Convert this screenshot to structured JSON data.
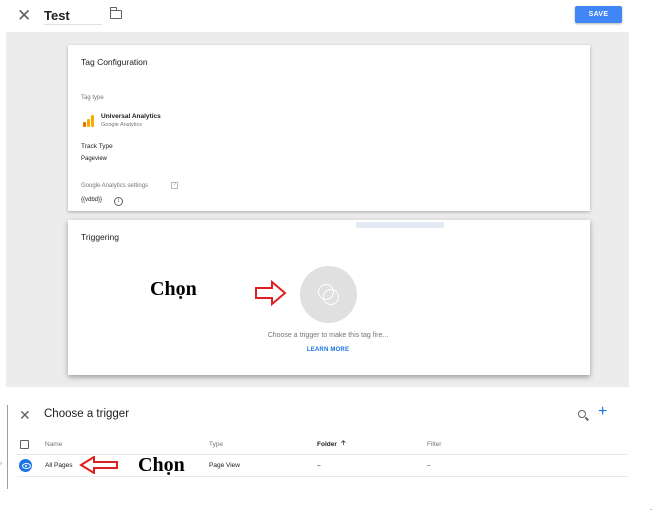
{
  "editor": {
    "title_value": "Test",
    "save_label": "SAVE"
  },
  "tag_config": {
    "heading": "Tag Configuration",
    "tag_type_label": "Tag type",
    "tag_name": "Universal Analytics",
    "tag_vendor": "Google Analytics",
    "track_type_label": "Track Type",
    "track_type_value": "Pageview",
    "ga_settings_label": "Google Analytics settings",
    "ga_settings_help": "?",
    "ga_settings_value": "{{vdbd}}"
  },
  "triggering": {
    "heading": "Triggering",
    "empty_message": "Choose a trigger to make this tag fire...",
    "learn_more": "LEARN MORE"
  },
  "annotations": {
    "top_label": "Chọn",
    "bottom_label": "Chọn"
  },
  "trigger_panel": {
    "title": "Choose a trigger",
    "columns": {
      "name": "Name",
      "type": "Type",
      "folder": "Folder",
      "folder_sort_glyph": "🡡",
      "filter": "Filter"
    },
    "rows": [
      {
        "name": "All Pages",
        "type": "Page View",
        "folder": "–",
        "filter": "–"
      }
    ]
  },
  "icons": [
    "close-icon",
    "folder-icon",
    "ga-logo-icon",
    "help-icon",
    "info-icon",
    "trigger-placeholder-icon",
    "search-icon",
    "plus-icon",
    "eye-icon",
    "sort-arrow-icon"
  ],
  "colors": {
    "accent": "#4285f4",
    "link": "#1a73e8",
    "annotation_arrow": "#e02020",
    "canvas": "#ececec"
  }
}
